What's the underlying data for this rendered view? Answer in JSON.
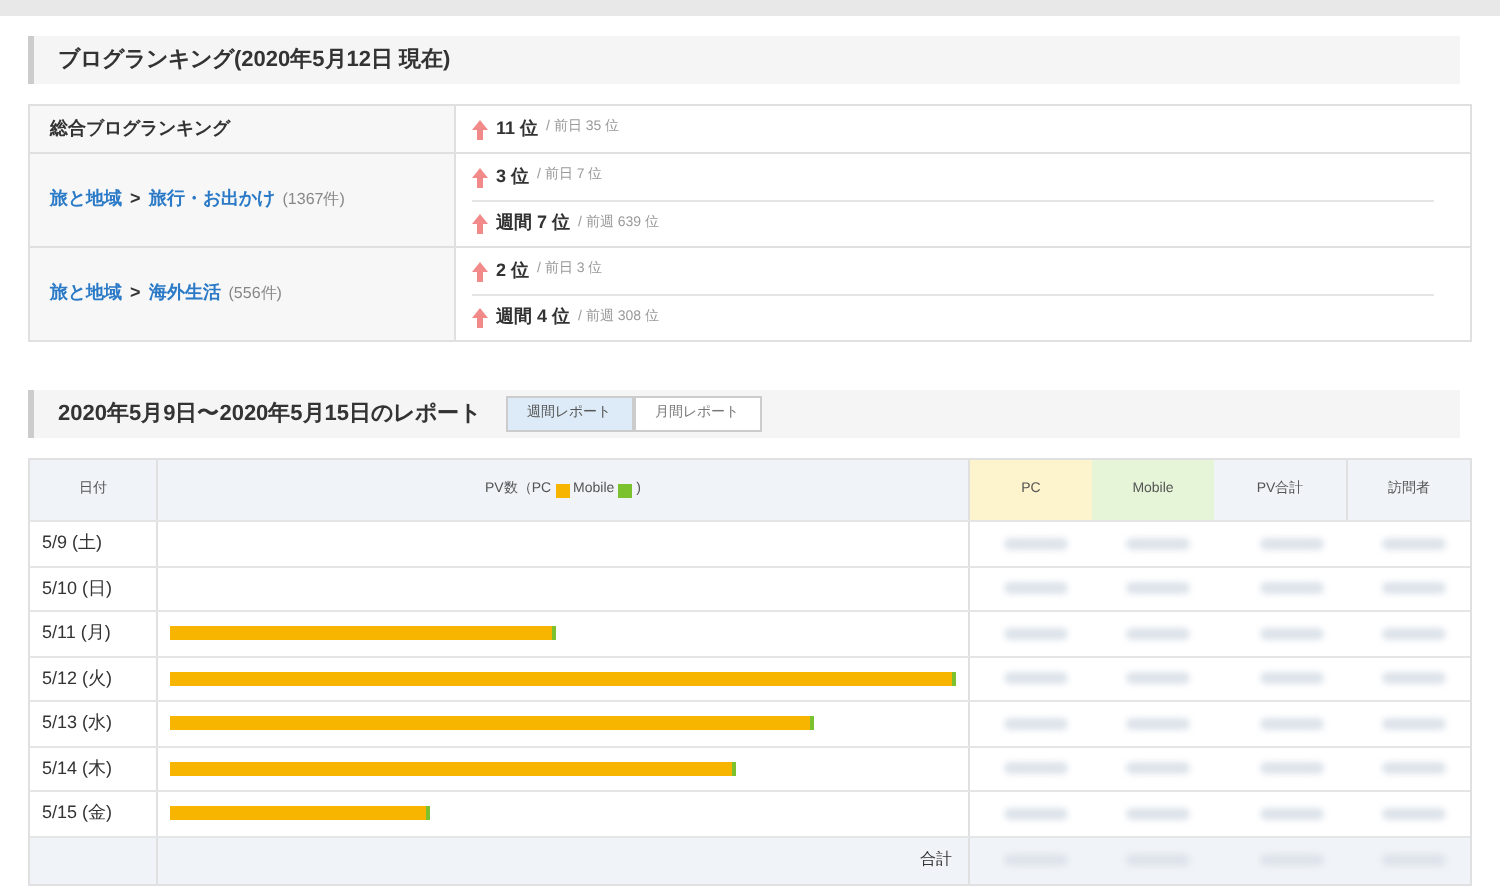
{
  "ranking": {
    "title": "ブログランキング(2020年5月12日 現在)",
    "rows": [
      {
        "category": [
          {
            "text": "総合ブログランキング",
            "kind": "plain"
          }
        ],
        "count": "",
        "ranks": [
          {
            "rank": "11 位",
            "previous": "/ 前日 35 位"
          }
        ]
      },
      {
        "category": [
          {
            "text": "旅と地域",
            "kind": "link"
          },
          {
            "text": ">",
            "kind": "sep"
          },
          {
            "text": "旅行・お出かけ",
            "kind": "link"
          }
        ],
        "count": "(1367件)",
        "ranks": [
          {
            "rank": "3 位",
            "previous": "/ 前日 7 位"
          },
          {
            "rank": "週間 7 位",
            "previous": "/ 前週 639 位"
          }
        ]
      },
      {
        "category": [
          {
            "text": "旅と地域",
            "kind": "link"
          },
          {
            "text": ">",
            "kind": "sep"
          },
          {
            "text": "海外生活",
            "kind": "link"
          }
        ],
        "count": "(556件)",
        "ranks": [
          {
            "rank": "2 位",
            "previous": "/ 前日 3 位"
          },
          {
            "rank": "週間 4 位",
            "previous": "/ 前週 308 位"
          }
        ]
      }
    ]
  },
  "report": {
    "title": "2020年5月9日〜2020年5月15日のレポート",
    "tabs": [
      {
        "label": "週間レポート",
        "selected": true
      },
      {
        "label": "月間レポート",
        "selected": false
      }
    ],
    "columns": {
      "date": "日付",
      "pv_prefix": "PV数（PC",
      "pv_mobile": "Mobile",
      "pv_suffix": ")",
      "pc": "PC",
      "mobile": "Mobile",
      "total": "PV合計",
      "visitors": "訪問者"
    },
    "rows": [
      {
        "date": "5/9 (土)"
      },
      {
        "date": "5/10 (日)"
      },
      {
        "date": "5/11 (月)",
        "level": 0.49
      },
      {
        "date": "5/12 (火)",
        "level": 1
      },
      {
        "date": "5/13 (水)",
        "level": 0.82
      },
      {
        "date": "5/14 (木)",
        "level": 0.72
      },
      {
        "date": "5/15 (金)",
        "level": 0.33
      }
    ],
    "total_label": "合計"
  }
}
